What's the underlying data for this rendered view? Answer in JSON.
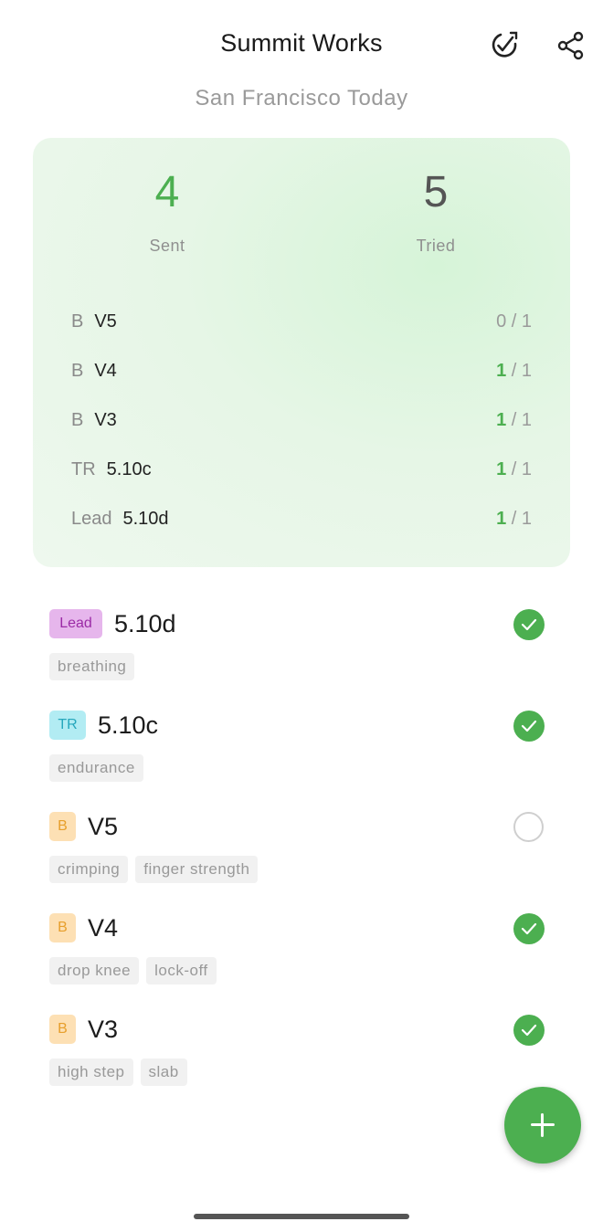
{
  "header": {
    "title": "Summit Works",
    "subtitle": "San Francisco Today",
    "icons": [
      "goal-check-icon",
      "share-icon"
    ]
  },
  "summary": {
    "sent": {
      "value": "4",
      "label": "Sent"
    },
    "tried": {
      "value": "5",
      "label": "Tried"
    },
    "rows": [
      {
        "discipline": "B",
        "grade": "V5",
        "sent": "0",
        "total": "/ 1"
      },
      {
        "discipline": "B",
        "grade": "V4",
        "sent": "1",
        "total": "/ 1"
      },
      {
        "discipline": "B",
        "grade": "V3",
        "sent": "1",
        "total": "/ 1"
      },
      {
        "discipline": "TR",
        "grade": "5.10c",
        "sent": "1",
        "total": "/ 1"
      },
      {
        "discipline": "Lead",
        "grade": "5.10d",
        "sent": "1",
        "total": "/ 1"
      }
    ]
  },
  "climbs": [
    {
      "type": "Lead",
      "grade": "5.10d",
      "tags": [
        "breathing"
      ],
      "sent": true
    },
    {
      "type": "TR",
      "grade": "5.10c",
      "tags": [
        "endurance"
      ],
      "sent": true
    },
    {
      "type": "B",
      "grade": "V5",
      "tags": [
        "crimping",
        "finger strength"
      ],
      "sent": false
    },
    {
      "type": "B",
      "grade": "V4",
      "tags": [
        "drop knee",
        "lock-off"
      ],
      "sent": true
    },
    {
      "type": "B",
      "grade": "V3",
      "tags": [
        "high step",
        "slab"
      ],
      "sent": true
    }
  ],
  "colors": {
    "accent_green": "#4caf50",
    "lead_badge": "#e6b6ec",
    "tr_badge": "#b2ecf3",
    "boulder_badge": "#fde0b4"
  }
}
